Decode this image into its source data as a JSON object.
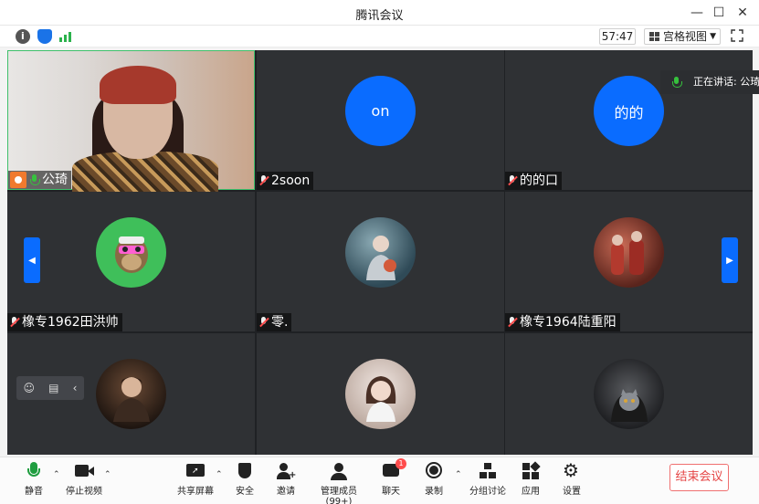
{
  "window": {
    "title": "腾讯会议"
  },
  "toolbar": {
    "timer": "57:47",
    "view_label": "宫格视图"
  },
  "speaking": "正在讲话: 公琦",
  "tiles": [
    {
      "name": "公琦",
      "type": "camera",
      "muted": false,
      "host": true
    },
    {
      "name": "2soon",
      "avatar_text": "on",
      "avatar_color": "#0a6cff"
    },
    {
      "name": "的的口",
      "avatar_text": "的的",
      "avatar_color": "#0a6cff"
    },
    {
      "name": "橡专1962田洪帅",
      "avatar_color": "#3fbf5a"
    },
    {
      "name": "零.",
      "avatar_color": "#4b6a7a"
    },
    {
      "name": "橡专1964陆重阳",
      "avatar_color": "#7a3a2a"
    },
    {
      "name": "",
      "avatar_color": "#5a4030"
    },
    {
      "name": "",
      "avatar_color": "#c9b8b0"
    },
    {
      "name": "",
      "avatar_color": "#3a3c40"
    }
  ],
  "bottombar": {
    "mute": "静音",
    "stop_video": "停止视频",
    "share": "共享屏幕",
    "security": "安全",
    "invite": "邀请",
    "members": "管理成员(99+)",
    "chat": "聊天",
    "chat_badge": "1",
    "record": "录制",
    "breakout": "分组讨论",
    "apps": "应用",
    "settings": "设置",
    "end": "结束会议"
  }
}
